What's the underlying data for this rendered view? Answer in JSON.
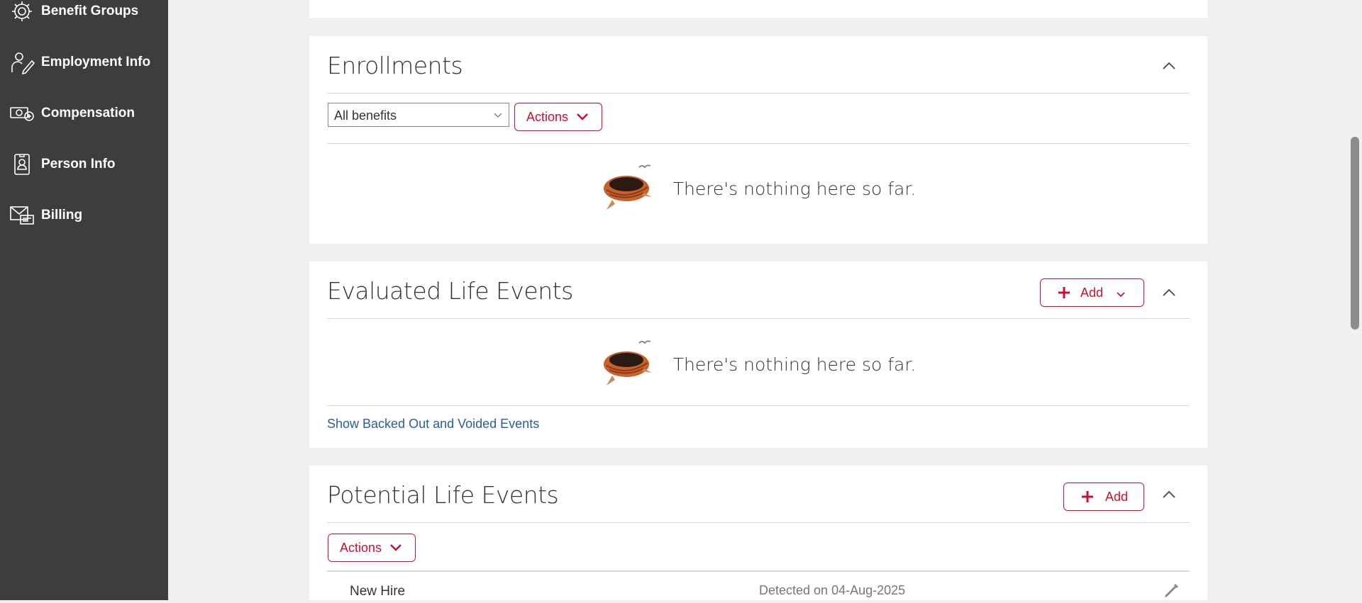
{
  "sidebar": {
    "items": [
      {
        "label": "Benefit Groups",
        "icon": "gear-people-icon"
      },
      {
        "label": "Employment Info",
        "icon": "person-pencil-icon"
      },
      {
        "label": "Compensation",
        "icon": "money-icon"
      },
      {
        "label": "Person Info",
        "icon": "id-badge-icon"
      },
      {
        "label": "Billing",
        "icon": "envelope-bill-icon"
      }
    ]
  },
  "enrollments": {
    "title": "Enrollments",
    "filter_value": "All benefits",
    "actions_label": "Actions",
    "empty_text": "There's nothing here so far."
  },
  "evaluated": {
    "title": "Evaluated Life Events",
    "add_label": "Add",
    "empty_text": "There's nothing here so far.",
    "show_backed_out": "Show Backed Out and Voided Events"
  },
  "potential": {
    "title": "Potential Life Events",
    "add_label": "Add",
    "actions_label": "Actions",
    "rows": [
      {
        "name": "New Hire",
        "detected": "Detected on 04-Aug-2025"
      }
    ]
  },
  "colors": {
    "accent": "#c8102e",
    "sidebar_bg": "#3d3d3d",
    "link": "#2a5d9f"
  }
}
